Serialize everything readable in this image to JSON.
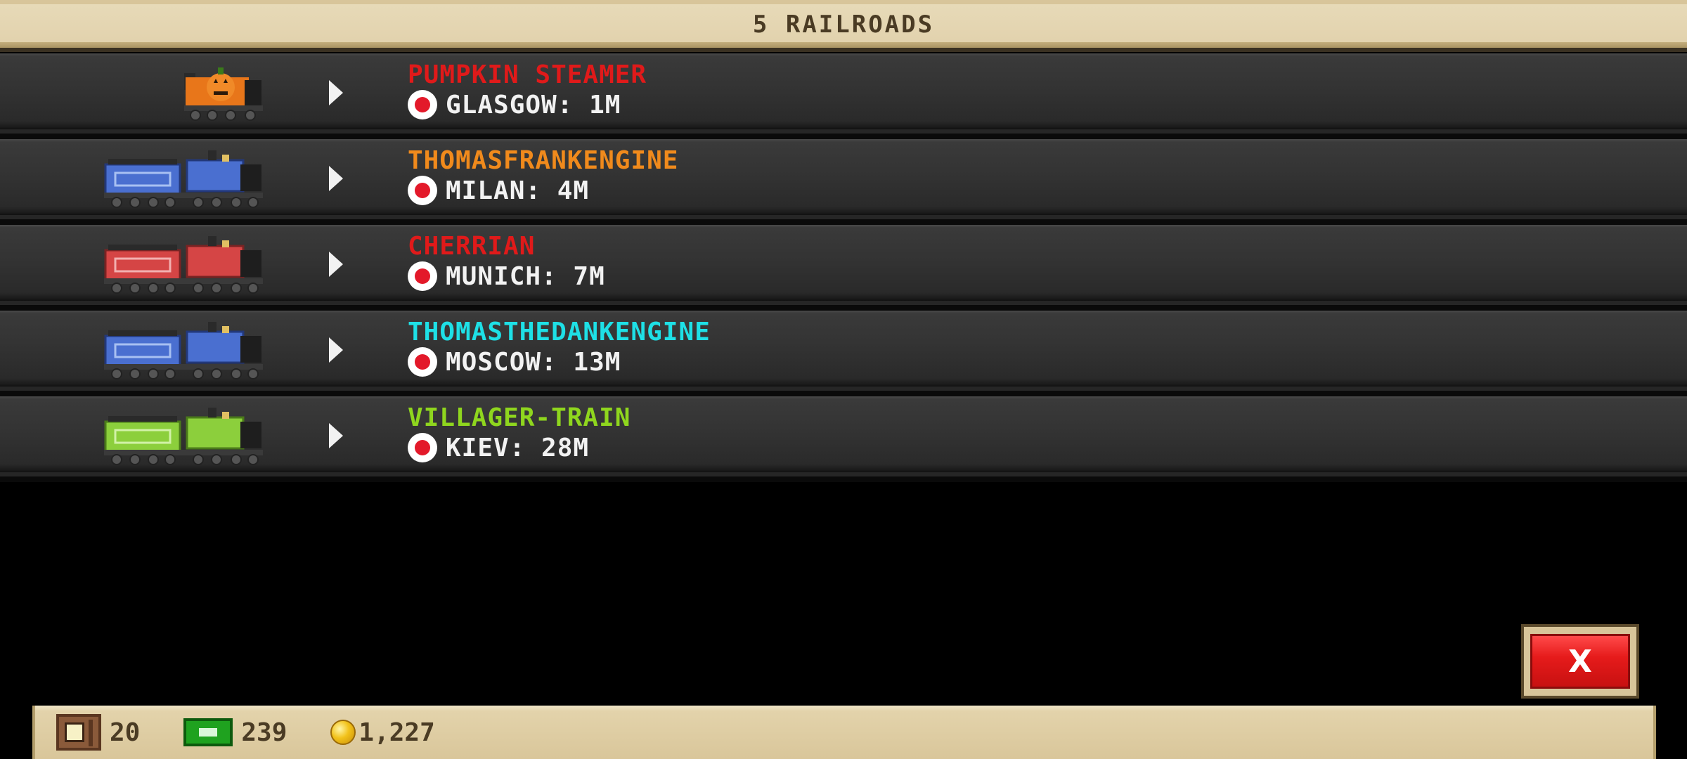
{
  "header": {
    "title": "5 RAILROADS"
  },
  "rows": [
    {
      "name": "PUMPKIN STEAMER",
      "name_color": "#e01a1a",
      "destination": "GLASGOW: 1M",
      "train": {
        "engine_color": "#e8761a",
        "has_tender": false,
        "icon": "pumpkin-engine-icon"
      }
    },
    {
      "name": "THOMASFRANKENGINE",
      "name_color": "#f08a1c",
      "destination": "MILAN: 4M",
      "train": {
        "engine_color": "#4a6fd0",
        "has_tender": true,
        "icon": "blue-engine-icon"
      }
    },
    {
      "name": "CHERRIAN",
      "name_color": "#e01a1a",
      "destination": "MUNICH: 7M",
      "train": {
        "engine_color": "#d54545",
        "has_tender": true,
        "icon": "red-engine-icon"
      }
    },
    {
      "name": "THOMASTHEDANKENGINE",
      "name_color": "#1ee0e6",
      "destination": "MOSCOW: 13M",
      "train": {
        "engine_color": "#4a6fd0",
        "has_tender": true,
        "icon": "blue-engine-icon"
      }
    },
    {
      "name": "VILLAGER-TRAIN",
      "name_color": "#8fd61e",
      "destination": "KIEV: 28M",
      "train": {
        "engine_color": "#8ccf3c",
        "has_tender": true,
        "icon": "green-engine-icon"
      }
    }
  ],
  "close_button": {
    "label": "X"
  },
  "footer": {
    "crates": "20",
    "cash": "239",
    "coins": "1,227"
  }
}
